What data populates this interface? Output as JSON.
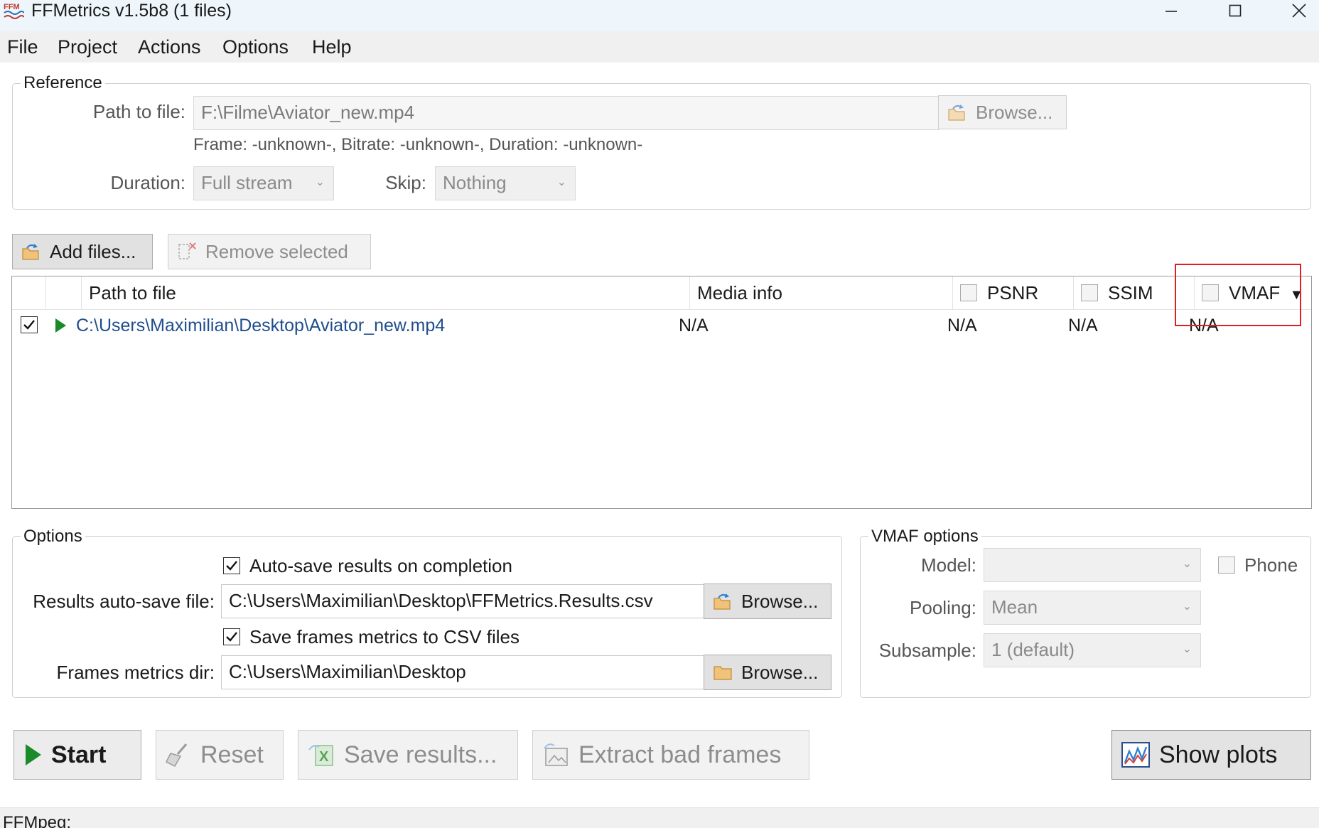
{
  "window": {
    "title": "FFMetrics v1.5b8 (1 files)",
    "icon": "ffm-app-icon"
  },
  "menu": {
    "items": [
      "File",
      "Project",
      "Actions",
      "Options",
      "Help"
    ]
  },
  "reference": {
    "group_label": "Reference",
    "path_label": "Path to file:",
    "path_value": "F:\\Filme\\Aviator_new.mp4",
    "browse_label": "Browse...",
    "info_text": "Frame: -unknown-, Bitrate: -unknown-, Duration: -unknown-",
    "duration_label": "Duration:",
    "duration_value": "Full stream",
    "skip_label": "Skip:",
    "skip_value": "Nothing"
  },
  "file_toolbar": {
    "add_label": "Add files...",
    "remove_label": "Remove selected"
  },
  "file_list": {
    "columns": {
      "path": "Path to file",
      "media": "Media info",
      "psnr": "PSNR",
      "ssim": "SSIM",
      "vmaf": "VMAF"
    },
    "rows": [
      {
        "checked": true,
        "path": "C:\\Users\\Maximilian\\Desktop\\Aviator_new.mp4",
        "media": "N/A",
        "psnr": "N/A",
        "ssim": "N/A",
        "vmaf": "N/A"
      }
    ],
    "highlight_color": "#e02020"
  },
  "options": {
    "group_label": "Options",
    "autosave_check_label": "Auto-save results on completion",
    "autosave_checked": true,
    "results_file_label": "Results auto-save file:",
    "results_file_value": "C:\\Users\\Maximilian\\Desktop\\FFMetrics.Results.csv",
    "browse_label": "Browse...",
    "save_frames_label": "Save frames metrics to CSV files",
    "save_frames_checked": true,
    "frames_dir_label": "Frames metrics dir:",
    "frames_dir_value": "C:\\Users\\Maximilian\\Desktop"
  },
  "vmaf_options": {
    "group_label": "VMAF options",
    "model_label": "Model:",
    "model_value": "",
    "phone_label": "Phone",
    "pooling_label": "Pooling:",
    "pooling_value": "Mean",
    "subsample_label": "Subsample:",
    "subsample_value": "1 (default)"
  },
  "actions": {
    "start_label": "Start",
    "reset_label": "Reset",
    "save_label": "Save results...",
    "extract_label": "Extract bad frames",
    "plots_label": "Show plots"
  },
  "status": {
    "text": "FFMpeg:"
  }
}
